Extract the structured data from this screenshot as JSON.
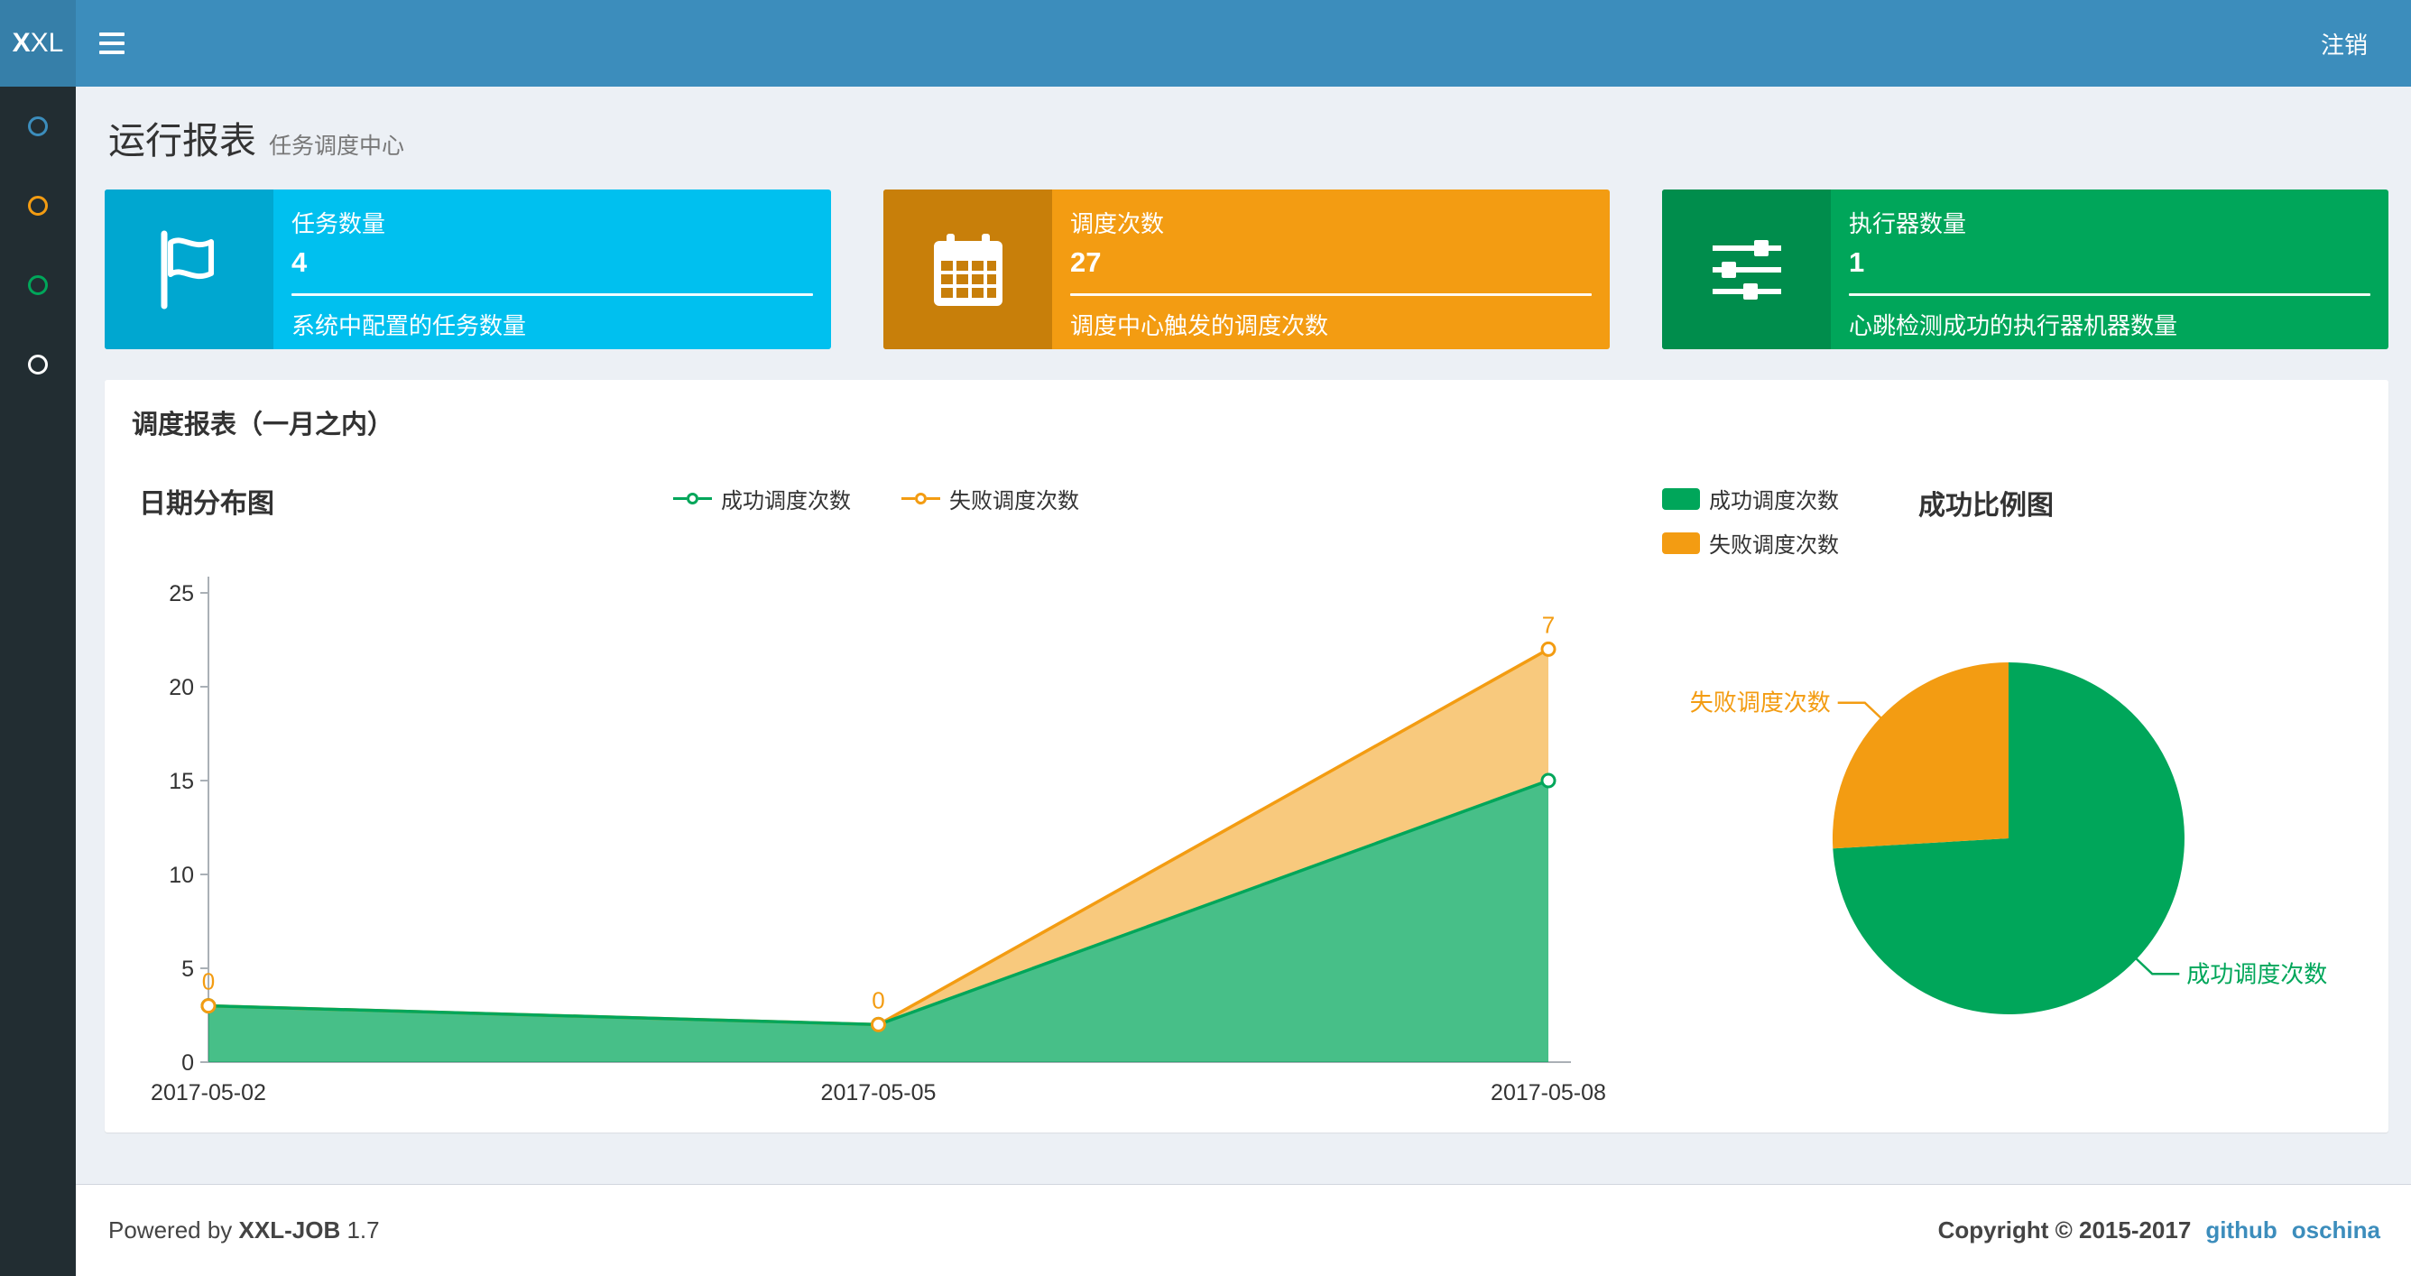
{
  "header": {
    "logo_bold": "X",
    "logo_rest": "XL",
    "logout_label": "注销",
    "bg_color": "#3c8dbc",
    "logo_bg_color": "#367fa9"
  },
  "sidebar": {
    "bg_color": "#222d32",
    "items": [
      {
        "name": "menu-report",
        "color": "#3c8dbc"
      },
      {
        "name": "menu-jobs",
        "color": "#f39c12"
      },
      {
        "name": "menu-executors",
        "color": "#00a65a"
      },
      {
        "name": "menu-help",
        "color": "#ffffff"
      }
    ]
  },
  "page": {
    "title": "运行报表",
    "subtitle": "任务调度中心"
  },
  "info_boxes": [
    {
      "title": "任务数量",
      "value": "4",
      "description": "系统中配置的任务数量",
      "color": "#00c0ef",
      "icon_bg": "#00a7d0",
      "icon": "flag-icon"
    },
    {
      "title": "调度次数",
      "value": "27",
      "description": "调度中心触发的调度次数",
      "color": "#f39c12",
      "icon_bg": "#c87f0a",
      "icon": "calendar-icon"
    },
    {
      "title": "执行器数量",
      "value": "1",
      "description": "心跳检测成功的执行器机器数量",
      "color": "#00a65a",
      "icon_bg": "#008d4c",
      "icon": "sliders-icon"
    }
  ],
  "panel": {
    "title": "调度报表（一月之内）"
  },
  "chart_data": [
    {
      "type": "area",
      "title": "日期分布图",
      "x": [
        "2017-05-02",
        "2017-05-05",
        "2017-05-08"
      ],
      "series": [
        {
          "name": "成功调度次数",
          "values": [
            3,
            2,
            15
          ],
          "color": "#00a65a"
        },
        {
          "name": "失败调度次数",
          "values": [
            0,
            0,
            7
          ],
          "color": "#f39c12"
        }
      ],
      "stacked": true,
      "ylim": [
        0,
        25
      ],
      "yticks": [
        0,
        5,
        10,
        15,
        20,
        25
      ],
      "point_labels": [
        "0",
        "0",
        "7"
      ],
      "legend": [
        "成功调度次数",
        "失败调度次数"
      ],
      "legend_position": "top-center",
      "grid": false
    },
    {
      "type": "pie",
      "title": "成功比例图",
      "slices": [
        {
          "name": "成功调度次数",
          "value": 20,
          "color": "#00a65a"
        },
        {
          "name": "失败调度次数",
          "value": 7,
          "color": "#f39c12"
        }
      ],
      "legend": [
        "成功调度次数",
        "失败调度次数"
      ],
      "legend_position": "top-left",
      "start_angle": 90,
      "clockwise": true
    }
  ],
  "footer": {
    "powered_by": "Powered by",
    "product": "XXL-JOB",
    "version": "1.7",
    "copyright": "Copyright © 2015-2017",
    "links": [
      {
        "label": "github"
      },
      {
        "label": "oschina"
      }
    ],
    "link_color": "#3c8dbc"
  }
}
